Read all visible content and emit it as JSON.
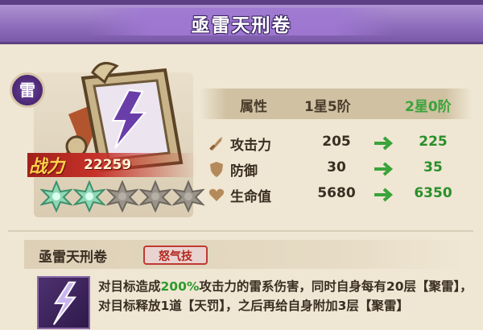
{
  "header": {
    "title": "亟雷天刑卷"
  },
  "card": {
    "element_badge": "雷",
    "power_label": "战力",
    "power_value": "22259",
    "stars_filled": 2,
    "stars_total": 5
  },
  "stats": {
    "header": {
      "attr": "属性",
      "from": "1星5阶",
      "to": "2星0阶"
    },
    "rows": [
      {
        "icon": "sword-icon",
        "label": "攻击力",
        "from": "205",
        "to": "225"
      },
      {
        "icon": "shield-icon",
        "label": "防御",
        "from": "30",
        "to": "35"
      },
      {
        "icon": "heart-icon",
        "label": "生命值",
        "from": "5680",
        "to": "6350"
      }
    ]
  },
  "skill": {
    "name": "亟雷天刑卷",
    "tag": "怒气技",
    "desc": {
      "p1": "对目标造成",
      "p2": "200%",
      "p3": "攻击力的雷系伤害，同时自身每有20层",
      "p4": "【聚雷】",
      "p5": "，对目标释放1道",
      "p6": "【天罚】",
      "p7": "，之后再给自身附加3层",
      "p8": "【聚雷】"
    }
  },
  "colors": {
    "header": "#8f6fbd",
    "upgrade": "#3aa33a",
    "tag": "#b3261e"
  }
}
